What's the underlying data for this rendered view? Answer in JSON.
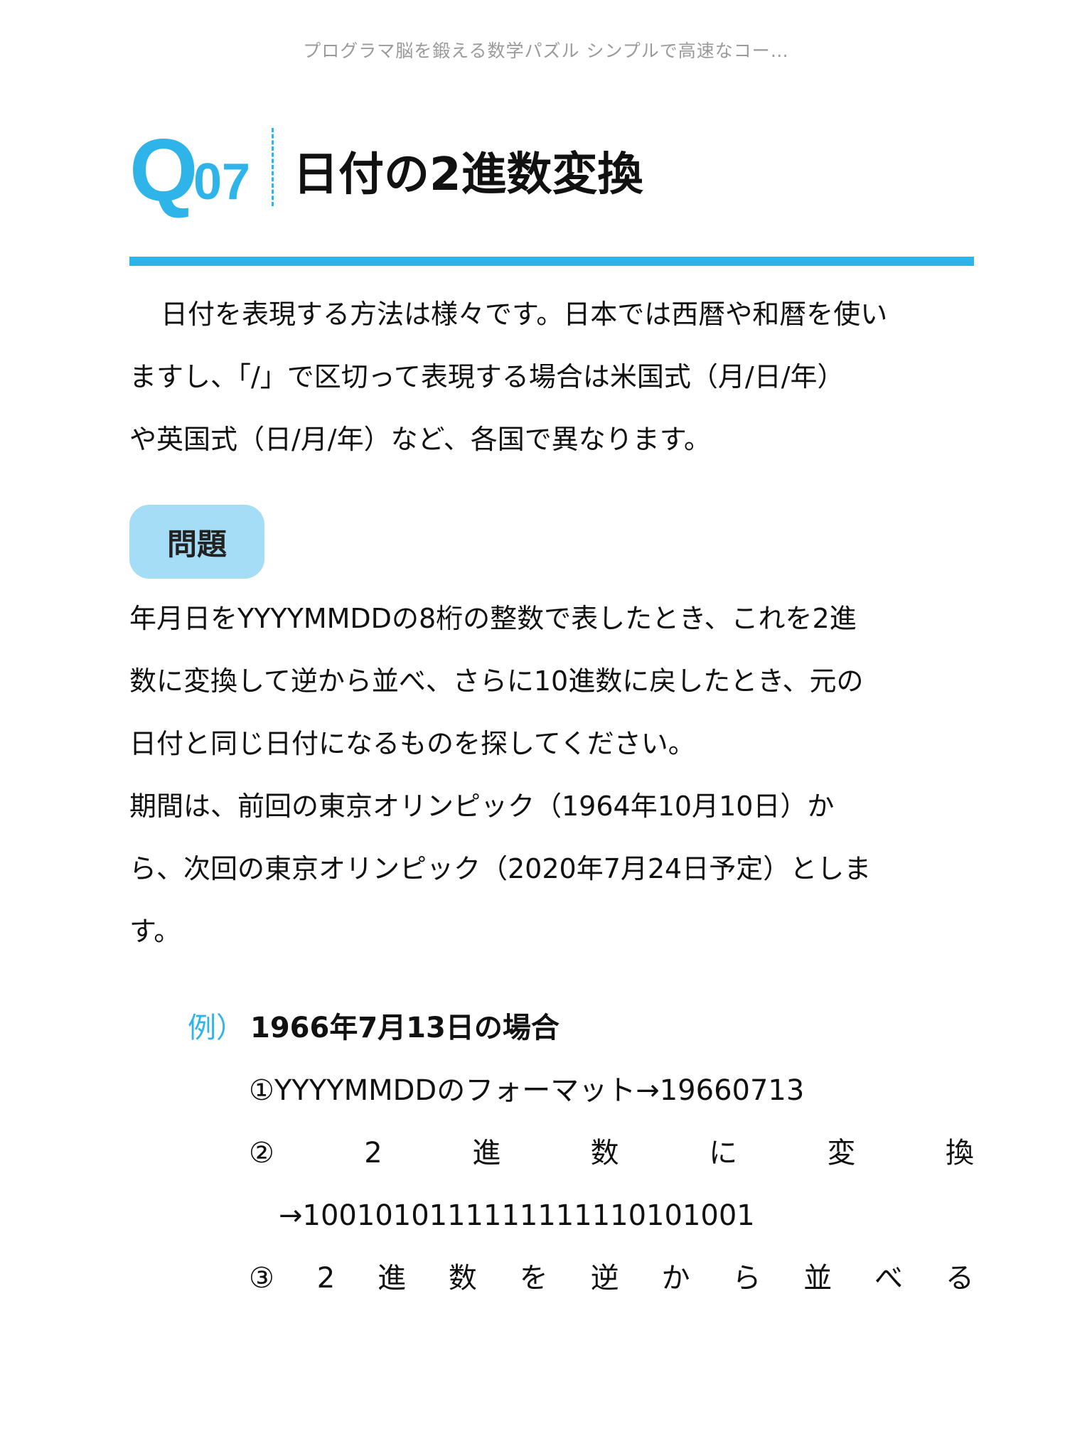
{
  "running_title": "プログラマ脳を鍛える数学パズル シンプルで高速なコー…",
  "question": {
    "letter": "Q",
    "number": "07",
    "title": "日付の2進数変換"
  },
  "intro_lines": [
    "日付を表現する方法は様々です。日本では西暦や和暦を使い",
    "ますし、「/」で区切って表現する場合は米国式（月/日/年）",
    "や英国式（日/月/年）など、各国で異なります。"
  ],
  "problem_label": "問題",
  "problem_lines": [
    "年月日をYYYYMMDDの8桁の整数で表したとき、これを2進",
    "数に変換して逆から並べ、さらに10進数に戻したとき、元の",
    "日付と同じ日付になるものを探してください。",
    "期間は、前回の東京オリンピック（1964年10月10日）か",
    "ら、次回の東京オリンピック（2020年7月24日予定）としま",
    "す。"
  ],
  "example": {
    "label": "例）",
    "heading": "1966年7月13日の場合",
    "step1": "①YYYYMMDDのフォーマット→19660713",
    "step2_chars": [
      "②",
      "2",
      "進",
      "数",
      "に",
      "変",
      "換"
    ],
    "step2_continuation": "→1001010111111111110101001",
    "step3_chars": [
      "③",
      "2",
      "進",
      "数",
      "を",
      "逆",
      "か",
      "ら",
      "並",
      "べ",
      "る"
    ]
  }
}
